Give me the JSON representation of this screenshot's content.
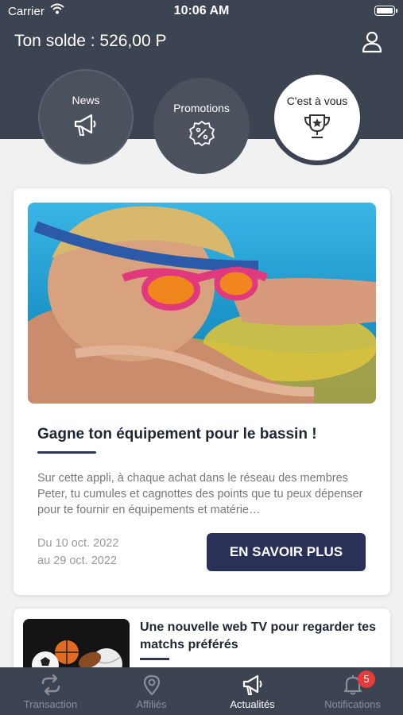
{
  "status_bar": {
    "carrier": "Carrier",
    "time": "10:06 AM"
  },
  "header": {
    "balance": "Ton solde : 526,00 P"
  },
  "categories": [
    {
      "label": "News",
      "icon": "megaphone-icon"
    },
    {
      "label": "Promotions",
      "icon": "percent-badge-icon"
    },
    {
      "label": "C'est à vous",
      "icon": "trophy-icon",
      "selected": true
    }
  ],
  "feature_card": {
    "title": "Gagne ton équipement pour le bassin !",
    "description": "Sur cette appli, à chaque achat dans le réseau des membres Peter, tu cumules et cagnottes des points que tu peux dépenser pour te fournir en équipements et matérie…",
    "date_from": "Du 10 oct. 2022",
    "date_to": "au 29 oct. 2022",
    "cta": "EN SAVOIR PLUS"
  },
  "second_card": {
    "title": "Une nouvelle web TV pour regarder tes matchs préférés"
  },
  "tabbar": {
    "items": [
      {
        "label": "Transaction",
        "icon": "transfer-icon"
      },
      {
        "label": "Affiliés",
        "icon": "location-pin-icon"
      },
      {
        "label": "Actualités",
        "icon": "megaphone-icon",
        "active": true
      },
      {
        "label": "Notifications",
        "icon": "bell-icon",
        "badge": "5"
      }
    ]
  },
  "colors": {
    "header_bg": "#3d4451",
    "accent": "#2a3158",
    "badge": "#e63b3b"
  }
}
